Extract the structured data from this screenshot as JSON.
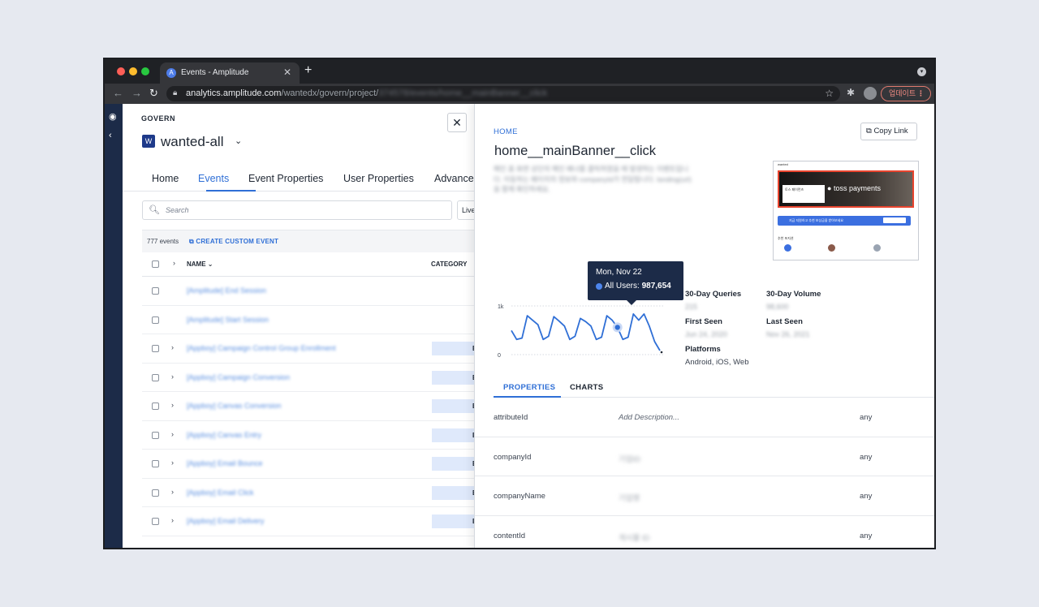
{
  "browser": {
    "tab_title": "Events - Amplitude",
    "url_host": "analytics.amplitude.com",
    "url_path": "/wantedx/govern/project/",
    "url_rest": "374578/events/home__mainBanner__click",
    "update_label": "업데이트"
  },
  "app": {
    "section": "GOVERN",
    "org_badge": "W",
    "org_name": "wanted-all",
    "nav_tabs": [
      {
        "label": "Home"
      },
      {
        "label": "Events"
      },
      {
        "label": "Event Properties"
      },
      {
        "label": "User Properties"
      },
      {
        "label": "Advance"
      }
    ],
    "search_placeholder": "Search",
    "live_filter": "Live",
    "event_count": "777 events",
    "create_custom": "CREATE CUSTOM EVENT",
    "col_name": "NAME",
    "col_category": "CATEGORY",
    "rows": [
      {
        "name": "[Amplitude] End Session",
        "category": "",
        "expand": ""
      },
      {
        "name": "[Amplitude] Start Session",
        "category": "",
        "expand": ""
      },
      {
        "name": "[Appboy] Campaign Control Group Enrollment",
        "category": "Bl",
        "expand": "›"
      },
      {
        "name": "[Appboy] Campaign Conversion",
        "category": "Bl",
        "expand": "›"
      },
      {
        "name": "[Appboy] Canvas Conversion",
        "category": "Bl",
        "expand": "›"
      },
      {
        "name": "[Appboy] Canvas Entry",
        "category": "Bl",
        "expand": "›"
      },
      {
        "name": "[Appboy] Email Bounce",
        "category": "Bl",
        "expand": "›"
      },
      {
        "name": "[Appboy] Email Click",
        "category": "Bl",
        "expand": "›"
      },
      {
        "name": "[Appboy] Email Delivery",
        "category": "Bl",
        "expand": "›"
      }
    ]
  },
  "detail": {
    "breadcrumb": "HOME",
    "copy_link": "Copy Link",
    "event_name": "home__mainBanner__click",
    "description": "메인 홈 화면 상단의 메인 배너를 클릭하였을 때 발생하는 이벤트입니다. 이동하는 페이지의 정보와 companyId가 전달됩니다. landing(url)을 함께 확인하세요.",
    "thumb_brand": "wanted",
    "thumb_banner_text": "toss payments",
    "thumb_card_text": "토스 페이먼츠",
    "thumb_bar_text": "지금 지원하고 추천 보상금을 받아보세요",
    "thumb_section": "추천 포지션",
    "tooltip_date": "Mon, Nov 22",
    "tooltip_series": "All Users:",
    "tooltip_value": "987,654",
    "stats": {
      "queries_label": "30-Day Queries",
      "queries_value": "215",
      "volume_label": "30-Day Volume",
      "volume_value": "98,600",
      "first_seen_label": "First Seen",
      "first_seen_value": "Jun 24, 2020",
      "last_seen_label": "Last Seen",
      "last_seen_value": "Nov 26, 2021",
      "platforms_label": "Platforms",
      "platforms_value": "Android, iOS, Web"
    },
    "prop_tabs": [
      {
        "label": "PROPERTIES"
      },
      {
        "label": "CHARTS"
      }
    ],
    "properties": [
      {
        "name": "attributeId",
        "desc": "Add Description...",
        "type": "any"
      },
      {
        "name": "companyId",
        "desc": "기업ID",
        "type": "any"
      },
      {
        "name": "companyName",
        "desc": "기업명",
        "type": "any"
      },
      {
        "name": "contentId",
        "desc": "게시물 ID",
        "type": "any"
      }
    ]
  },
  "colors": {
    "accent": "#2f6fd6",
    "nav_dark": "#1c2b48",
    "line": "#2f6fd6",
    "tooltip_bg": "#1c2b48"
  },
  "chart_data": {
    "type": "line",
    "yticks": [
      "0",
      "1k"
    ],
    "series": [
      {
        "values": [
          0.45,
          0.25,
          0.28,
          0.78,
          0.68,
          0.58,
          0.25,
          0.32,
          0.76,
          0.66,
          0.55,
          0.25,
          0.32,
          0.72,
          0.65,
          0.55,
          0.25,
          0.3,
          0.78,
          0.68,
          0.52,
          0.25,
          0.3,
          0.82,
          0.68,
          0.82,
          0.55,
          0.2,
          0.0
        ]
      }
    ],
    "highlight_index": 20
  }
}
